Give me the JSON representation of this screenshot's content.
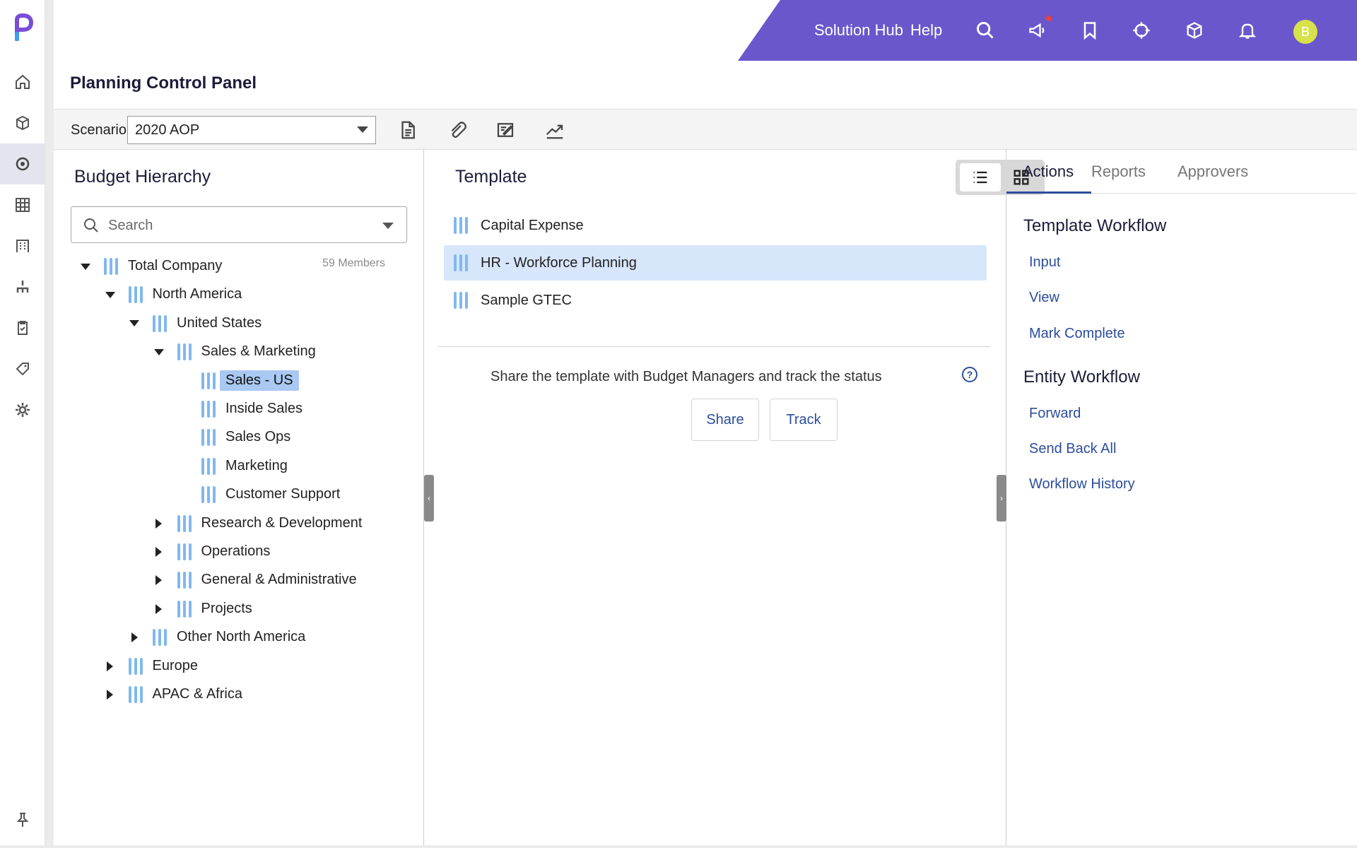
{
  "header": {
    "solution_hub": "Solution Hub",
    "help": "Help",
    "avatar_initial": "B"
  },
  "page": {
    "title": "Planning Control Panel"
  },
  "toolbar": {
    "scenario_label": "Scenario",
    "scenario_value": "2020 AOP"
  },
  "hierarchy": {
    "title": "Budget Hierarchy",
    "search_placeholder": "Search",
    "members_count": "59 Members",
    "nodes": [
      {
        "label": "Total Company",
        "level": 0,
        "state": "expanded"
      },
      {
        "label": "North America",
        "level": 1,
        "state": "expanded"
      },
      {
        "label": "United States",
        "level": 2,
        "state": "expanded"
      },
      {
        "label": "Sales & Marketing",
        "level": 3,
        "state": "expanded"
      },
      {
        "label": "Sales - US",
        "level": 4,
        "state": "leaf",
        "selected": true
      },
      {
        "label": "Inside Sales",
        "level": 4,
        "state": "leaf"
      },
      {
        "label": "Sales Ops",
        "level": 4,
        "state": "leaf"
      },
      {
        "label": "Marketing",
        "level": 4,
        "state": "leaf"
      },
      {
        "label": "Customer Support",
        "level": 4,
        "state": "leaf"
      },
      {
        "label": "Research & Development",
        "level": 3,
        "state": "collapsed"
      },
      {
        "label": "Operations",
        "level": 3,
        "state": "collapsed"
      },
      {
        "label": "General & Administrative",
        "level": 3,
        "state": "collapsed"
      },
      {
        "label": "Projects",
        "level": 3,
        "state": "collapsed"
      },
      {
        "label": "Other North America",
        "level": 2,
        "state": "collapsed"
      },
      {
        "label": "Europe",
        "level": 1,
        "state": "collapsed"
      },
      {
        "label": "APAC & Africa",
        "level": 1,
        "state": "collapsed"
      }
    ]
  },
  "template": {
    "title": "Template",
    "items": [
      {
        "label": "Capital Expense"
      },
      {
        "label": "HR - Workforce Planning",
        "selected": true
      },
      {
        "label": "Sample GTEC"
      }
    ],
    "share_text": "Share the template with Budget Managers and track the status",
    "share_button": "Share",
    "track_button": "Track"
  },
  "right_panel": {
    "tabs": [
      "Actions",
      "Reports",
      "Approvers"
    ],
    "active_tab": "Actions",
    "template_workflow": {
      "title": "Template Workflow",
      "links": [
        "Input",
        "View",
        "Mark Complete"
      ]
    },
    "entity_workflow": {
      "title": "Entity Workflow",
      "links": [
        "Forward",
        "Send Back All",
        "Workflow History"
      ]
    }
  },
  "colors": {
    "brand_purple": "#6b57cc",
    "link_blue": "#2d4d9c",
    "bar_blue": "#80b8f0",
    "selection_blue": "#a9c8f2"
  }
}
